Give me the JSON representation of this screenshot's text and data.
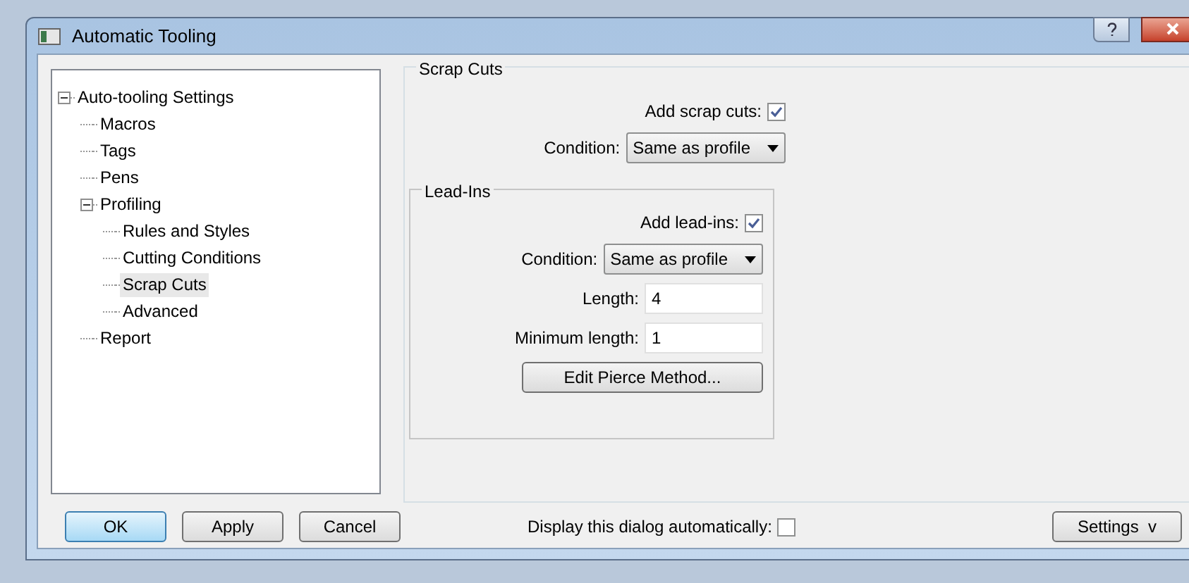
{
  "window": {
    "title": "Automatic Tooling"
  },
  "tree": [
    {
      "label": "Auto-tooling Settings",
      "expanded": true,
      "selected": false,
      "children": [
        {
          "label": "Macros",
          "selected": false
        },
        {
          "label": "Tags",
          "selected": false
        },
        {
          "label": "Pens",
          "selected": false
        },
        {
          "label": "Profiling",
          "expanded": true,
          "selected": false,
          "children": [
            {
              "label": "Rules and Styles",
              "selected": false
            },
            {
              "label": "Cutting Conditions",
              "selected": false
            },
            {
              "label": "Scrap Cuts",
              "selected": true
            },
            {
              "label": "Advanced",
              "selected": false
            }
          ]
        },
        {
          "label": "Report",
          "selected": false
        }
      ]
    }
  ],
  "scrap_cuts": {
    "title": "Scrap Cuts",
    "add_label": "Add scrap cuts:",
    "add_checked": true,
    "condition_label": "Condition:",
    "condition_value": "Same as profile"
  },
  "lead_ins": {
    "title": "Lead-Ins",
    "add_label": "Add lead-ins:",
    "add_checked": true,
    "condition_label": "Condition:",
    "condition_value": "Same as profile",
    "length_label": "Length:",
    "length_value": "4",
    "min_label": "Minimum length:",
    "min_value": "1",
    "button": "Edit Pierce Method..."
  },
  "buttons": [
    {
      "label": "OK",
      "default": true
    },
    {
      "label": "Apply",
      "default": false
    },
    {
      "label": "Cancel",
      "default": false
    }
  ],
  "display_auto": {
    "label": "Display this dialog automatically:",
    "checked": false
  },
  "settings_button": "Settings  v"
}
